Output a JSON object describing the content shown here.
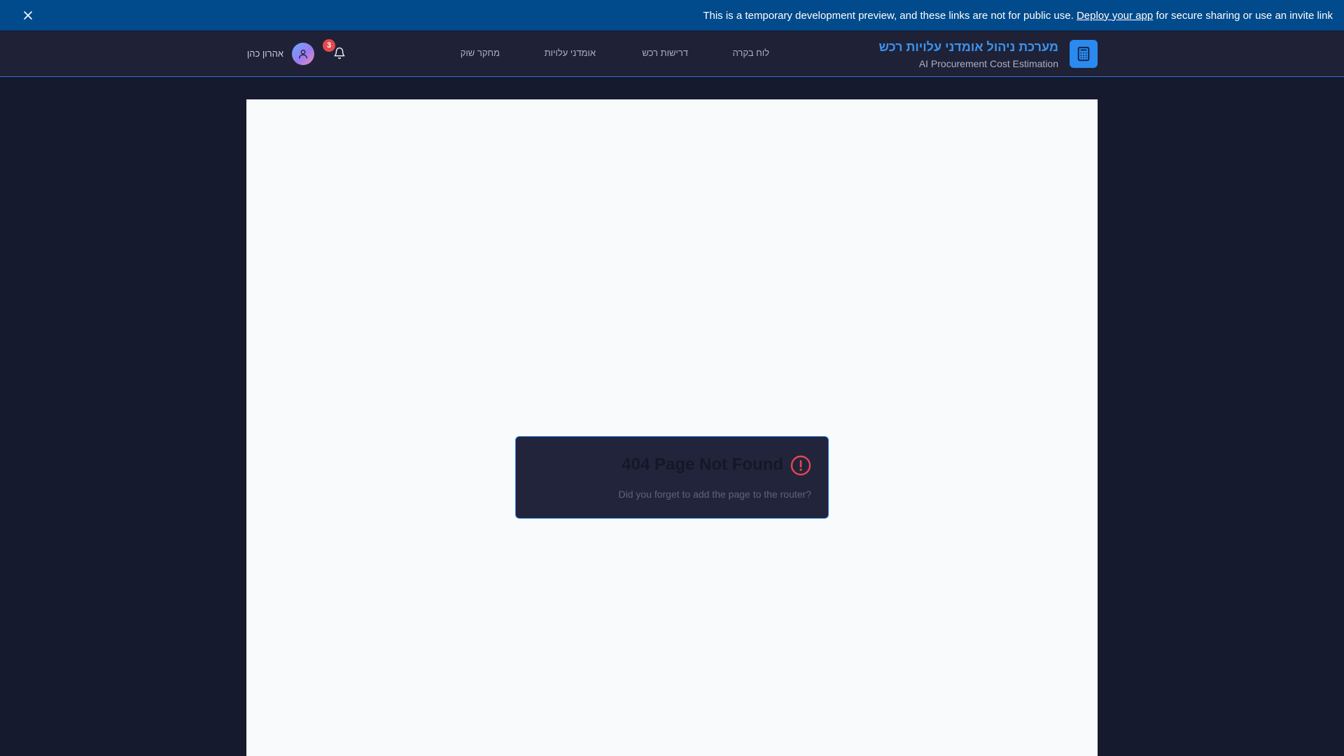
{
  "banner": {
    "text_before": "This is a temporary development preview, and these links are not for public use.",
    "link_text": "Deploy your app",
    "text_after": "for secure sharing or use an invite link",
    "close_icon": "close-icon"
  },
  "brand": {
    "title": "מערכת ניהול אומדני עלויות רכש",
    "subtitle": "AI Procurement Cost Estimation",
    "icon": "calculator-icon",
    "accent_color": "#2a8af0"
  },
  "nav": {
    "items": [
      {
        "label": "לוח בקרה"
      },
      {
        "label": "דרישות רכש"
      },
      {
        "label": "אומדני עלויות"
      },
      {
        "label": "מחקר שוק"
      }
    ]
  },
  "notifications": {
    "count": "3",
    "icon": "bell-icon"
  },
  "user": {
    "name": "אהרון כהן",
    "icon": "user-icon"
  },
  "error": {
    "title": "404 Page Not Found",
    "message": "Did you forget to add the page to the router?",
    "icon": "alert-circle-icon",
    "icon_color": "#e5484d"
  }
}
